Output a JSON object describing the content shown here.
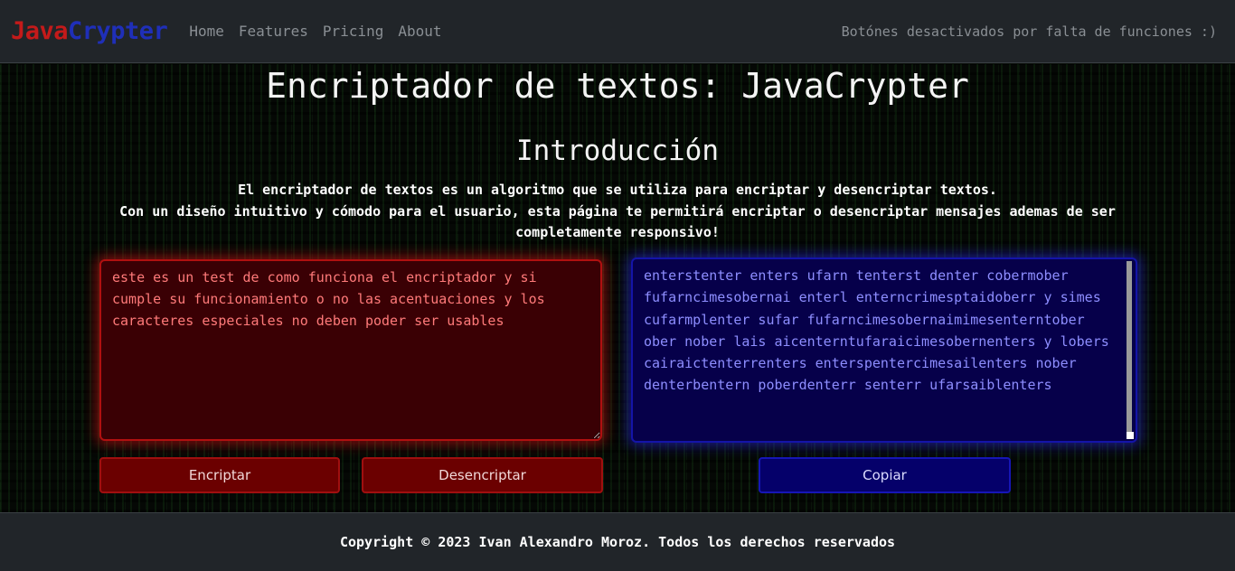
{
  "navbar": {
    "brand_java": "Java",
    "brand_crypter": "Crypter",
    "links": [
      "Home",
      "Features",
      "Pricing",
      "About"
    ],
    "note": "Botónes desactivados por falta de funciones :)"
  },
  "main": {
    "title": "Encriptador de textos: JavaCrypter",
    "intro_title": "Introducción",
    "intro_line1": "El encriptador de textos es un algoritmo que se utiliza para encriptar y desencriptar textos.",
    "intro_line2": "Con un diseño intuitivo y cómodo para el usuario, esta página te permitirá encriptar o desencriptar mensajes ademas de ser completamente responsivo!",
    "input_value": "este es un test de como funciona el encriptador y si cumple su funcionamiento o no las acentuaciones y los caracteres especiales no deben poder ser usables",
    "output_value": "enterstenter enters ufarn tenterst denter cobermober fufarncimesobernai enterl enterncrimesptaidoberr y simes cufarmplenter sufar fufarncimesobernaimimesenterntober ober nober lais aicenterntufaraicimesobernenters y lobers cairaictenterrenters enterspentercimesailenters nober denterbentern poberdenterr senterr ufarsaiblenters",
    "buttons": {
      "encrypt": "Encriptar",
      "decrypt": "Desencriptar",
      "copy": "Copiar"
    }
  },
  "footer": {
    "copyright": "Copyright © 2023 Ivan Alexandro Moroz. Todos los derechos reservados"
  },
  "colors": {
    "accent_red": "#c41a1a",
    "accent_blue": "#1f2fb8",
    "navbar_bg": "#212529"
  }
}
